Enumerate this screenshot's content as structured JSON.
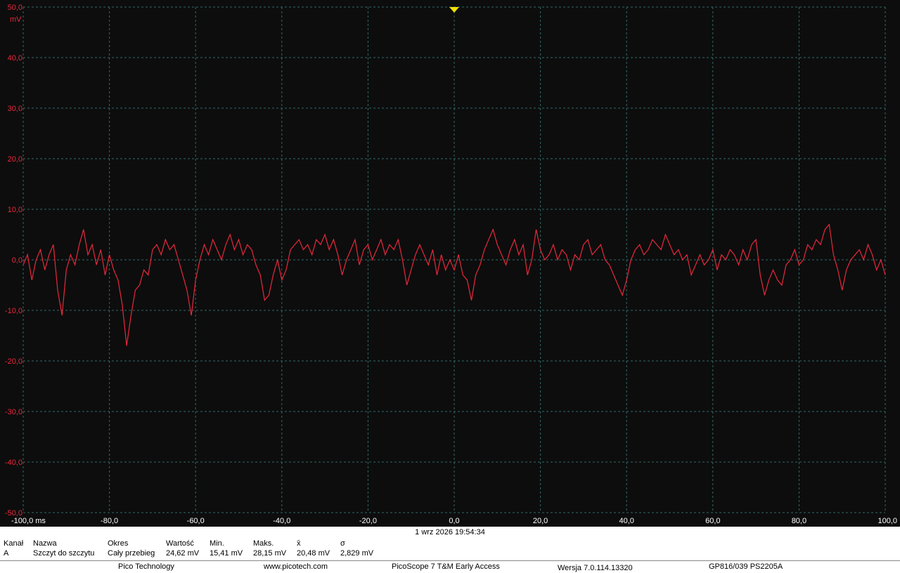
{
  "chart_data": {
    "type": "line",
    "y_unit": "mV",
    "x_unit": "ms",
    "xlim": [
      -100,
      100
    ],
    "ylim": [
      -50,
      50
    ],
    "grid": true,
    "x_ticks": [
      {
        "v": -100,
        "label": "-100,0 ms"
      },
      {
        "v": -80,
        "label": "-80,0"
      },
      {
        "v": -60,
        "label": "-60,0"
      },
      {
        "v": -40,
        "label": "-40,0"
      },
      {
        "v": -20,
        "label": "-20,0"
      },
      {
        "v": 0,
        "label": "0,0"
      },
      {
        "v": 20,
        "label": "20,0"
      },
      {
        "v": 40,
        "label": "40,0"
      },
      {
        "v": 60,
        "label": "60,0"
      },
      {
        "v": 80,
        "label": "80,0"
      },
      {
        "v": 100,
        "label": "100,0"
      }
    ],
    "y_ticks": [
      {
        "v": 50,
        "label": "50,0"
      },
      {
        "v": 40,
        "label": "40,0"
      },
      {
        "v": 30,
        "label": "30,0"
      },
      {
        "v": 20,
        "label": "20,0"
      },
      {
        "v": 10,
        "label": "10,0"
      },
      {
        "v": 0,
        "label": "0,0"
      },
      {
        "v": -10,
        "label": "-10,0"
      },
      {
        "v": -20,
        "label": "-20,0"
      },
      {
        "v": -30,
        "label": "-30,0"
      },
      {
        "v": -40,
        "label": "-40,0"
      },
      {
        "v": -50,
        "label": "-50,0"
      }
    ],
    "trigger_time": 0,
    "series": [
      {
        "color": "#e8283c",
        "points": [
          [
            -100,
            -1
          ],
          [
            -99,
            1
          ],
          [
            -98,
            -4
          ],
          [
            -97,
            0
          ],
          [
            -96,
            2
          ],
          [
            -95,
            -2
          ],
          [
            -94,
            1
          ],
          [
            -93,
            3
          ],
          [
            -92,
            -6
          ],
          [
            -91,
            -11
          ],
          [
            -90,
            -2
          ],
          [
            -89,
            1
          ],
          [
            -88,
            -1
          ],
          [
            -87,
            3
          ],
          [
            -86,
            6
          ],
          [
            -85,
            1
          ],
          [
            -84,
            3
          ],
          [
            -83,
            -1
          ],
          [
            -82,
            2
          ],
          [
            -81,
            -3
          ],
          [
            -80,
            1
          ],
          [
            -79,
            -2
          ],
          [
            -78,
            -4
          ],
          [
            -77,
            -9
          ],
          [
            -76,
            -17
          ],
          [
            -75,
            -11
          ],
          [
            -74,
            -6
          ],
          [
            -73,
            -5
          ],
          [
            -72,
            -2
          ],
          [
            -71,
            -3
          ],
          [
            -70,
            2
          ],
          [
            -69,
            3
          ],
          [
            -68,
            1
          ],
          [
            -67,
            4
          ],
          [
            -66,
            2
          ],
          [
            -65,
            3
          ],
          [
            -64,
            0
          ],
          [
            -63,
            -3
          ],
          [
            -62,
            -6
          ],
          [
            -61,
            -11
          ],
          [
            -60,
            -4
          ],
          [
            -59,
            0
          ],
          [
            -58,
            3
          ],
          [
            -57,
            1
          ],
          [
            -56,
            4
          ],
          [
            -55,
            2
          ],
          [
            -54,
            0
          ],
          [
            -53,
            3
          ],
          [
            -52,
            5
          ],
          [
            -51,
            2
          ],
          [
            -50,
            4
          ],
          [
            -49,
            1
          ],
          [
            -48,
            3
          ],
          [
            -47,
            2
          ],
          [
            -46,
            -1
          ],
          [
            -45,
            -3
          ],
          [
            -44,
            -8
          ],
          [
            -43,
            -7
          ],
          [
            -42,
            -3
          ],
          [
            -41,
            0
          ],
          [
            -40,
            -4
          ],
          [
            -39,
            -2
          ],
          [
            -38,
            2
          ],
          [
            -37,
            3
          ],
          [
            -36,
            4
          ],
          [
            -35,
            2
          ],
          [
            -34,
            3
          ],
          [
            -33,
            1
          ],
          [
            -32,
            4
          ],
          [
            -31,
            3
          ],
          [
            -30,
            5
          ],
          [
            -29,
            2
          ],
          [
            -28,
            4
          ],
          [
            -27,
            1
          ],
          [
            -26,
            -3
          ],
          [
            -25,
            0
          ],
          [
            -24,
            2
          ],
          [
            -23,
            4
          ],
          [
            -22,
            -1
          ],
          [
            -21,
            2
          ],
          [
            -20,
            3
          ],
          [
            -19,
            0
          ],
          [
            -18,
            2
          ],
          [
            -17,
            4
          ],
          [
            -16,
            1
          ],
          [
            -15,
            3
          ],
          [
            -14,
            2
          ],
          [
            -13,
            4
          ],
          [
            -12,
            0
          ],
          [
            -11,
            -5
          ],
          [
            -10,
            -2
          ],
          [
            -9,
            1
          ],
          [
            -8,
            3
          ],
          [
            -7,
            1
          ],
          [
            -6,
            -1
          ],
          [
            -5,
            2
          ],
          [
            -4,
            -3
          ],
          [
            -3,
            1
          ],
          [
            -2,
            -2
          ],
          [
            -1,
            0
          ],
          [
            0,
            -2
          ],
          [
            1,
            1
          ],
          [
            2,
            -3
          ],
          [
            3,
            -4
          ],
          [
            4,
            -8
          ],
          [
            5,
            -3
          ],
          [
            6,
            -1
          ],
          [
            7,
            2
          ],
          [
            8,
            4
          ],
          [
            9,
            6
          ],
          [
            10,
            3
          ],
          [
            11,
            1
          ],
          [
            12,
            -1
          ],
          [
            13,
            2
          ],
          [
            14,
            4
          ],
          [
            15,
            1
          ],
          [
            16,
            3
          ],
          [
            17,
            -3
          ],
          [
            18,
            0
          ],
          [
            19,
            6
          ],
          [
            20,
            2
          ],
          [
            21,
            0
          ],
          [
            22,
            1
          ],
          [
            23,
            3
          ],
          [
            24,
            0
          ],
          [
            25,
            2
          ],
          [
            26,
            1
          ],
          [
            27,
            -2
          ],
          [
            28,
            1
          ],
          [
            29,
            0
          ],
          [
            30,
            3
          ],
          [
            31,
            4
          ],
          [
            32,
            1
          ],
          [
            33,
            2
          ],
          [
            34,
            3
          ],
          [
            35,
            0
          ],
          [
            36,
            -1
          ],
          [
            37,
            -3
          ],
          [
            38,
            -5
          ],
          [
            39,
            -7
          ],
          [
            40,
            -4
          ],
          [
            41,
            0
          ],
          [
            42,
            2
          ],
          [
            43,
            3
          ],
          [
            44,
            1
          ],
          [
            45,
            2
          ],
          [
            46,
            4
          ],
          [
            47,
            3
          ],
          [
            48,
            2
          ],
          [
            49,
            5
          ],
          [
            50,
            3
          ],
          [
            51,
            1
          ],
          [
            52,
            2
          ],
          [
            53,
            0
          ],
          [
            54,
            1
          ],
          [
            55,
            -3
          ],
          [
            56,
            -1
          ],
          [
            57,
            1
          ],
          [
            58,
            -1
          ],
          [
            59,
            0
          ],
          [
            60,
            2
          ],
          [
            61,
            -2
          ],
          [
            62,
            1
          ],
          [
            63,
            0
          ],
          [
            64,
            2
          ],
          [
            65,
            1
          ],
          [
            66,
            -1
          ],
          [
            67,
            2
          ],
          [
            68,
            0
          ],
          [
            69,
            3
          ],
          [
            70,
            4
          ],
          [
            71,
            -3
          ],
          [
            72,
            -7
          ],
          [
            73,
            -4
          ],
          [
            74,
            -2
          ],
          [
            75,
            -4
          ],
          [
            76,
            -5
          ],
          [
            77,
            -1
          ],
          [
            78,
            0
          ],
          [
            79,
            2
          ],
          [
            80,
            -1
          ],
          [
            81,
            0
          ],
          [
            82,
            3
          ],
          [
            83,
            2
          ],
          [
            84,
            4
          ],
          [
            85,
            3
          ],
          [
            86,
            6
          ],
          [
            87,
            7
          ],
          [
            88,
            1
          ],
          [
            89,
            -2
          ],
          [
            90,
            -6
          ],
          [
            91,
            -2
          ],
          [
            92,
            0
          ],
          [
            93,
            1
          ],
          [
            94,
            2
          ],
          [
            95,
            0
          ],
          [
            96,
            3
          ],
          [
            97,
            1
          ],
          [
            98,
            -2
          ],
          [
            99,
            0
          ],
          [
            100,
            -3
          ]
        ]
      }
    ],
    "trigger_marker_color": "#f0e000"
  },
  "footer": {
    "timestamp": "1 wrz 2026 19:54:34",
    "measurements": {
      "headers": [
        "Kanał",
        "Nazwa",
        "Okres",
        "Wartość",
        "Min.",
        "Maks.",
        "x̄",
        "σ"
      ],
      "row": [
        "A",
        "Szczyt do szczytu",
        "Cały przebieg",
        "24,62 mV",
        "15,41 mV",
        "28,15 mV",
        "20,48 mV",
        "2,829 mV"
      ]
    },
    "info": [
      "Pico Technology",
      "www.picotech.com",
      "PicoScope 7 T&M Early Access",
      "Wersja 7.0.114.13320",
      "GP816/039 PS2205A"
    ]
  }
}
